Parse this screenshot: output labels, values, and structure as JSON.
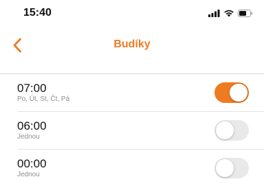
{
  "status_bar": {
    "time": "15:40",
    "icons": [
      "signal-icon",
      "wifi-icon",
      "battery-icon"
    ]
  },
  "nav": {
    "back_icon": "chevron-left-icon",
    "title": "Budíky"
  },
  "colors": {
    "accent": "#EE7B22",
    "toggle_off": "#e9e9ea"
  },
  "alarms": [
    {
      "time": "07:00",
      "repeat": "Po, Út, St, Čt, Pá",
      "enabled": true
    },
    {
      "time": "06:00",
      "repeat": "Jednou",
      "enabled": false
    },
    {
      "time": "00:00",
      "repeat": "Jednou",
      "enabled": false
    }
  ]
}
